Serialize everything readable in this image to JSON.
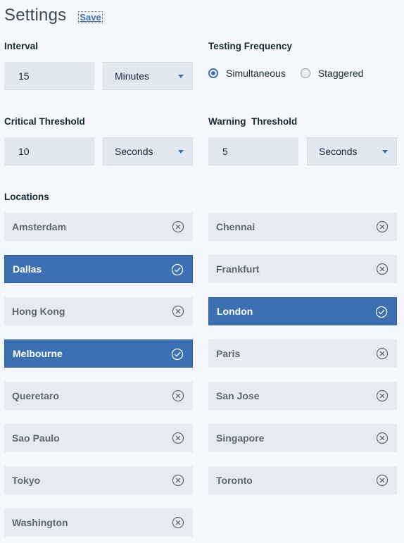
{
  "header": {
    "title": "Settings",
    "save_label": "Save"
  },
  "interval": {
    "label": "Interval",
    "value": "15",
    "unit": "Minutes"
  },
  "testing_frequency": {
    "label": "Testing Frequency",
    "options": [
      {
        "label": "Simultaneous",
        "selected": true
      },
      {
        "label": "Staggered",
        "selected": false
      }
    ]
  },
  "critical_threshold": {
    "label": "Critical Threshold",
    "value": "10",
    "unit": "Seconds"
  },
  "warning_threshold": {
    "label": "Warning  Threshold",
    "value": "5",
    "unit": "Seconds"
  },
  "locations": {
    "label": "Locations",
    "items": [
      {
        "name": "Amsterdam",
        "selected": false,
        "icon": "close-circle-icon"
      },
      {
        "name": "Chennai",
        "selected": false,
        "icon": "close-circle-icon"
      },
      {
        "name": "Dallas",
        "selected": true,
        "icon": "check-circle-icon"
      },
      {
        "name": "Frankfurt",
        "selected": false,
        "icon": "close-circle-icon"
      },
      {
        "name": "Hong Kong",
        "selected": false,
        "icon": "close-circle-icon"
      },
      {
        "name": "London",
        "selected": true,
        "icon": "check-circle-icon"
      },
      {
        "name": "Melbourne",
        "selected": true,
        "icon": "check-circle-icon"
      },
      {
        "name": "Paris",
        "selected": false,
        "icon": "close-circle-icon"
      },
      {
        "name": "Queretaro",
        "selected": false,
        "icon": "close-circle-icon"
      },
      {
        "name": "San Jose",
        "selected": false,
        "icon": "close-circle-icon"
      },
      {
        "name": "Sao Paulo",
        "selected": false,
        "icon": "close-circle-icon"
      },
      {
        "name": "Singapore",
        "selected": false,
        "icon": "close-circle-icon"
      },
      {
        "name": "Tokyo",
        "selected": false,
        "icon": "close-circle-icon"
      },
      {
        "name": "Toronto",
        "selected": false,
        "icon": "close-circle-icon"
      },
      {
        "name": "Washington",
        "selected": false,
        "icon": "close-circle-icon"
      }
    ]
  },
  "colors": {
    "accent": "#3d70b2",
    "background": "#f4f7fb",
    "field": "#e1e8f2",
    "tile": "#e6ebf3",
    "muted_text": "#5a6872"
  }
}
